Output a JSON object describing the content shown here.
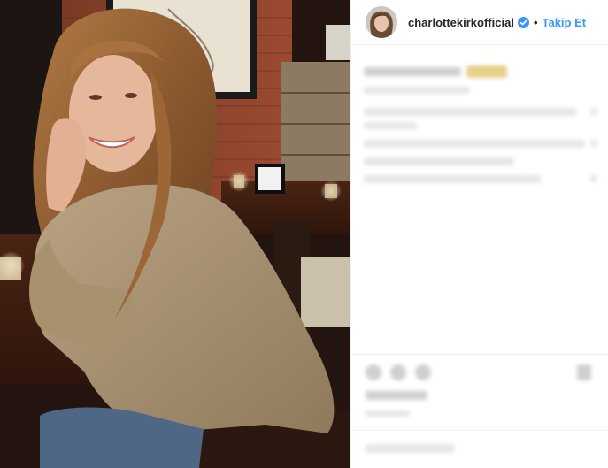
{
  "post": {
    "username": "charlottekirkofficial",
    "separator": "•",
    "follow_label": "Takip Et"
  },
  "icons": {
    "verified": "verified-badge-icon",
    "avatar": "profile-avatar"
  },
  "colors": {
    "follow_blue": "#3897f0",
    "verified_blue": "#3897f0",
    "text_dark": "#262626",
    "divider": "#efefef"
  }
}
